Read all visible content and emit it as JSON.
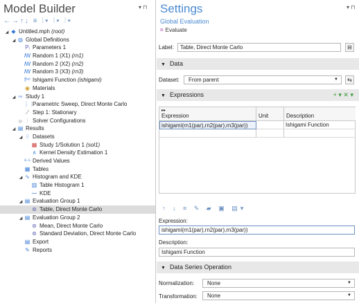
{
  "model_builder": {
    "title": "Model Builder",
    "pin": "▾ ⊓",
    "toolbar": "←→↑↓ ≡ ⫶▾ ⫶▾ ⫶▾",
    "tree": [
      {
        "label": "Untitled.mph",
        "tag": "(root)",
        "indent": 0,
        "twisty": "◢",
        "icon": "◆",
        "icon_color": "#3a7bd5"
      },
      {
        "label": "Global Definitions",
        "tag": "",
        "indent": 1,
        "twisty": "◢",
        "icon": "◍",
        "icon_color": "#3a7bd5"
      },
      {
        "label": "Parameters 1",
        "tag": "",
        "indent": 2,
        "twisty": "",
        "icon": "Pᵢ",
        "icon_color": "#6060b0"
      },
      {
        "label": "Random 1 (X1)",
        "tag": "(rn1)",
        "indent": 2,
        "twisty": "",
        "icon": "ꟿ",
        "icon_color": "#3a7bd5"
      },
      {
        "label": "Random 2 (X2)",
        "tag": "(rn2)",
        "indent": 2,
        "twisty": "",
        "icon": "ꟿ",
        "icon_color": "#3a7bd5"
      },
      {
        "label": "Random 3 (X3)",
        "tag": "(rn3)",
        "indent": 2,
        "twisty": "",
        "icon": "ꟿ",
        "icon_color": "#3a7bd5"
      },
      {
        "label": "Ishigami Function",
        "tag": "(ishigami)",
        "indent": 2,
        "twisty": "",
        "icon": "f⁽ˣ⁾",
        "icon_color": "#3a7bd5"
      },
      {
        "label": "Materials",
        "tag": "",
        "indent": 2,
        "twisty": "",
        "icon": "◉",
        "icon_color": "#d0a030"
      },
      {
        "label": "Study 1",
        "tag": "",
        "indent": 1,
        "twisty": "◢",
        "icon": "∾",
        "icon_color": "#3a7bd5"
      },
      {
        "label": "Parametric Sweep, Direct Monte Carlo",
        "tag": "",
        "indent": 2,
        "twisty": "",
        "icon": "⋮⋮",
        "icon_color": "#3a7bd5"
      },
      {
        "label": "Step 1: Stationary",
        "tag": "",
        "indent": 2,
        "twisty": "",
        "icon": "⟋",
        "icon_color": "#555"
      },
      {
        "label": "Solver Configurations",
        "tag": "",
        "indent": 2,
        "twisty": "▷",
        "icon": "⫶",
        "icon_color": "#3a7bd5"
      },
      {
        "label": "Results",
        "tag": "",
        "indent": 1,
        "twisty": "◢",
        "icon": "▤",
        "icon_color": "#3a7bd5"
      },
      {
        "label": "Datasets",
        "tag": "",
        "indent": 2,
        "twisty": "◢",
        "icon": "⦙⦙",
        "icon_color": "#3a7bd5"
      },
      {
        "label": "Study 1/Solution 1",
        "tag": "(sol1)",
        "indent": 3,
        "twisty": "",
        "icon": "▦",
        "icon_color": "#d04040"
      },
      {
        "label": "Kernel Density Estimation 1",
        "tag": "",
        "indent": 3,
        "twisty": "",
        "icon": "∧",
        "icon_color": "#3a7bd5"
      },
      {
        "label": "Derived Values",
        "tag": "",
        "indent": 2,
        "twisty": "",
        "icon": "⁸·⁵",
        "icon_color": "#3a7bd5"
      },
      {
        "label": "Tables",
        "tag": "",
        "indent": 2,
        "twisty": "",
        "icon": "▦",
        "icon_color": "#3a7bd5"
      },
      {
        "label": "Histogram and KDE",
        "tag": "",
        "indent": 2,
        "twisty": "◢",
        "icon": "∿",
        "icon_color": "#3a7bd5"
      },
      {
        "label": "Table Histogram 1",
        "tag": "",
        "indent": 3,
        "twisty": "",
        "icon": "▥",
        "icon_color": "#3a7bd5"
      },
      {
        "label": "KDE",
        "tag": "",
        "indent": 3,
        "twisty": "",
        "icon": "⁓",
        "icon_color": "#3a7bd5"
      },
      {
        "label": "Evaluation Group 1",
        "tag": "",
        "indent": 2,
        "twisty": "◢",
        "icon": "▤",
        "icon_color": "#3a7bd5"
      },
      {
        "label": "Table, Direct Monte Carlo",
        "tag": "",
        "indent": 3,
        "twisty": "",
        "icon": "⊚",
        "icon_color": "#6060b0",
        "selected": true
      },
      {
        "label": "Evaluation Group 2",
        "tag": "",
        "indent": 2,
        "twisty": "◢",
        "icon": "▤",
        "icon_color": "#3a7bd5"
      },
      {
        "label": "Mean, Direct Monte Carlo",
        "tag": "",
        "indent": 3,
        "twisty": "",
        "icon": "⊚",
        "icon_color": "#6060b0"
      },
      {
        "label": "Standard Deviation, Direct Monte Carlo",
        "tag": "",
        "indent": 3,
        "twisty": "",
        "icon": "⊚",
        "icon_color": "#6060b0"
      },
      {
        "label": "Export",
        "tag": "",
        "indent": 2,
        "twisty": "",
        "icon": "▤",
        "icon_color": "#3a7bd5"
      },
      {
        "label": "Reports",
        "tag": "",
        "indent": 2,
        "twisty": "",
        "icon": "✎",
        "icon_color": "#3a7bd5"
      }
    ]
  },
  "settings": {
    "title": "Settings",
    "pin": "▾ ⊓",
    "subtitle": "Global Evaluation",
    "evaluate": "Evaluate",
    "label_caption": "Label:",
    "label_value": "Table, Direct Monte Carlo",
    "data_section": "Data",
    "dataset_caption": "Dataset:",
    "dataset_value": "From parent",
    "expressions_section": "Expressions",
    "expr_section_icons": "+ ▾ ✕ ▾",
    "table": {
      "headers": [
        "Expression",
        "Unit",
        "Description"
      ],
      "rows": [
        [
          "ishigami(rn1(par),rn2(par),rn3(par))",
          "",
          "Ishigami Function"
        ],
        [
          "",
          "",
          ""
        ]
      ]
    },
    "table_toolbar": "↑ ↓ ≡ ✎ ▰ ▣ ▤▾",
    "expression_caption": "Expression:",
    "expression_value": "ishigami(rn1(par),rn2(par),rn3(par))",
    "description_caption": "Description:",
    "description_value": "Ishigami Function",
    "dso_section": "Data Series Operation",
    "normalization_caption": "Normalization:",
    "normalization_value": "None",
    "transformation_caption": "Transformation:",
    "transformation_value": "None"
  }
}
